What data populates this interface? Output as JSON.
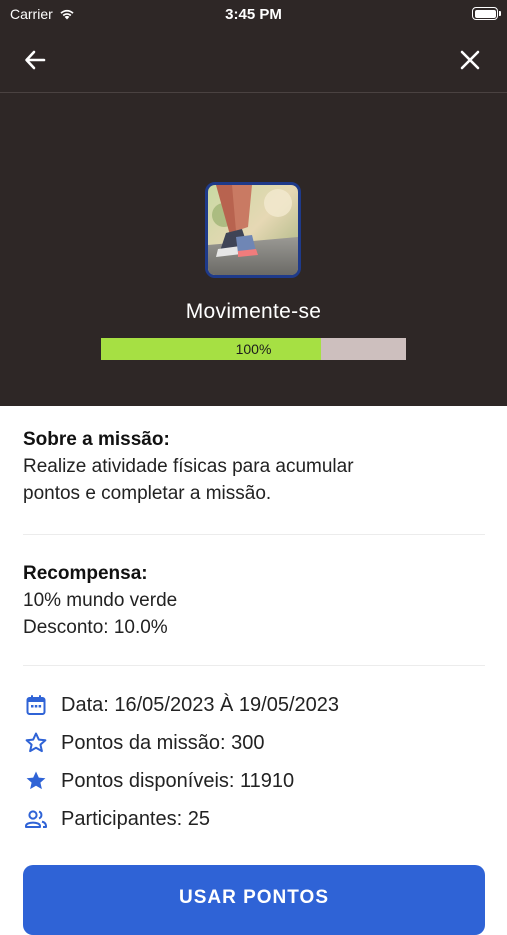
{
  "status_bar": {
    "carrier": "Carrier",
    "time": "3:45 PM"
  },
  "header": {
    "mission_name": "Movimente-se",
    "progress_label": "100%",
    "progress_fill_fraction": 0.72
  },
  "about": {
    "title": "Sobre a missão:",
    "line1": "Realize atividade físicas para acumular",
    "line2": "pontos e completar a missão."
  },
  "reward": {
    "title": "Recompensa:",
    "line1": "10% mundo verde",
    "line2": "Desconto: 10.0%"
  },
  "details": {
    "date": "Data: 16/05/2023 À 19/05/2023",
    "mission_points": "Pontos da missão: 300",
    "available_points": "Pontos disponíveis: 11910",
    "participants": "Participantes: 25"
  },
  "cta": {
    "label": "USAR PONTOS"
  },
  "colors": {
    "header_bg": "#2e2726",
    "progress_fill": "#a6e043",
    "accent": "#2f63d6"
  }
}
